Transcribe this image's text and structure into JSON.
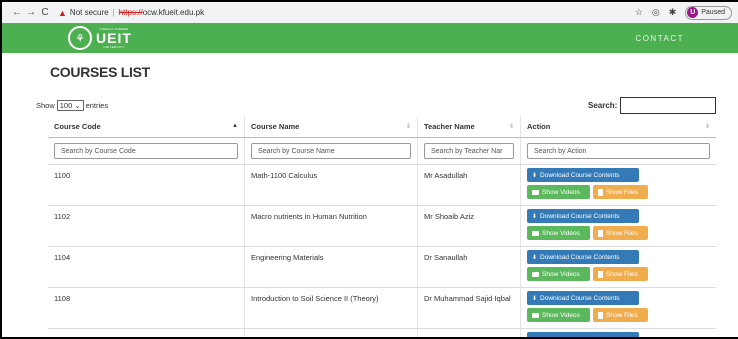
{
  "browser": {
    "back": "←",
    "forward": "→",
    "reload": "C",
    "security": "Not secure",
    "url_scheme": "https://",
    "url_host": "ocw.kfueit.edu.pk",
    "profile_initial": "U",
    "profile_status": "Paused"
  },
  "header": {
    "logo_small": "KHWAJA FAREED",
    "logo_text": "UEIT",
    "logo_tagline": "UNIVERSITY",
    "contact": "CONTACT"
  },
  "page": {
    "title": "COURSES LIST",
    "show_label": "Show",
    "entries_value": "100",
    "entries_label": "entries",
    "search_label": "Search:"
  },
  "table": {
    "headers": [
      "Course Code",
      "Course Name",
      "Teacher Name",
      "Action"
    ],
    "filters": [
      "Search by Course Code",
      "Search by Course Name",
      "Search by Teacher Nar",
      "Search by Action"
    ],
    "actions": {
      "download": "Download Course Contents",
      "videos": "Show Videos",
      "files": "Show Files"
    },
    "rows": [
      {
        "code": "1100",
        "name": "Math-1100 Calculus",
        "teacher": "Mr Asadullah"
      },
      {
        "code": "1102",
        "name": "Macro nutrients in Human Nutrition",
        "teacher": "Mr Shoaib Aziz"
      },
      {
        "code": "1104",
        "name": "Engineering Materials",
        "teacher": "Dr Sanaullah"
      },
      {
        "code": "1108",
        "name": "Introduction to Soil Science II (Theory)",
        "teacher": "Dr Muhammad Sajid Iqbal"
      }
    ]
  }
}
